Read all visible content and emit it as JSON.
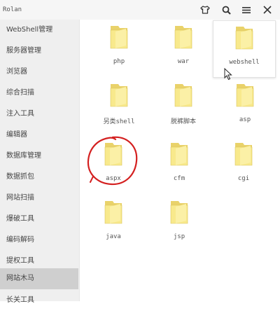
{
  "window": {
    "title": "Rolan"
  },
  "toolbar": {
    "icons": [
      "shirt-icon",
      "search-icon",
      "menu-icon",
      "close-icon"
    ]
  },
  "sidebar": {
    "items": [
      {
        "label": "WebShell管理"
      },
      {
        "label": "服务器管理"
      },
      {
        "label": "浏览器"
      },
      {
        "label": "综合扫描"
      },
      {
        "label": "注入工具"
      },
      {
        "label": "编辑器"
      },
      {
        "label": "数据库管理"
      },
      {
        "label": "数据抓包"
      },
      {
        "label": "网站扫描"
      },
      {
        "label": "爆破工具"
      },
      {
        "label": "编码解码"
      },
      {
        "label": "提权工具"
      },
      {
        "label": "网站木马",
        "active": true
      },
      {
        "label": "长关工具"
      }
    ]
  },
  "folders": [
    {
      "label": "php"
    },
    {
      "label": "war"
    },
    {
      "label": "webshell"
    },
    {
      "label": "另类shell"
    },
    {
      "label": "脱裤脚本"
    },
    {
      "label": "asp"
    },
    {
      "label": "aspx"
    },
    {
      "label": "cfm"
    },
    {
      "label": "cgi"
    },
    {
      "label": "java"
    },
    {
      "label": "jsp"
    }
  ],
  "colors": {
    "folder_fill": "#f8e98c",
    "folder_dark": "#e9d26a",
    "annotation": "#d42020",
    "sidebar_active": "#cfcfcf"
  }
}
